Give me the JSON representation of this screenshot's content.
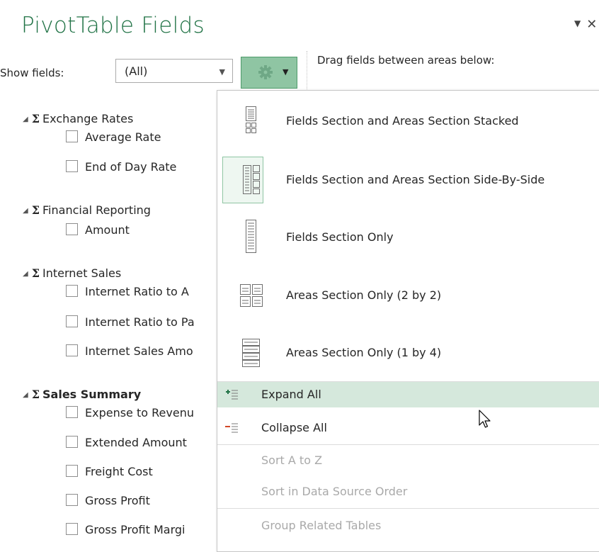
{
  "pane": {
    "title": "PivotTable Fields",
    "controls": {
      "dropdown_glyph": "▼",
      "close_glyph": "✕"
    },
    "show_fields_label": "Show fields:",
    "show_fields_value": "(All)",
    "drag_hint": "Drag fields between areas below:"
  },
  "field_groups": [
    {
      "name": "Exchange Rates",
      "bold": false,
      "fields": [
        "Average Rate",
        "End of Day Rate"
      ]
    },
    {
      "name": "Financial Reporting",
      "bold": false,
      "fields": [
        "Amount"
      ]
    },
    {
      "name": "Internet Sales",
      "bold": false,
      "fields": [
        "Internet Ratio to A",
        "Internet Ratio to Pa",
        "Internet Sales Amo"
      ]
    },
    {
      "name": "Sales Summary",
      "bold": true,
      "fields": [
        "Expense to Revenu",
        "Extended Amount",
        "Freight Cost",
        "Gross Profit",
        "Gross Profit Margi"
      ]
    }
  ],
  "tools_menu": {
    "layout_options": [
      {
        "label": "Fields Section and Areas Section Stacked",
        "icon": "layout-stacked-icon",
        "selected": false
      },
      {
        "label": "Fields Section and Areas Section Side-By-Side",
        "icon": "layout-side-by-side-icon",
        "selected": true
      },
      {
        "label": "Fields Section Only",
        "icon": "layout-fields-only-icon",
        "selected": false
      },
      {
        "label": "Areas Section Only (2 by 2)",
        "icon": "layout-areas-2x2-icon",
        "selected": false
      },
      {
        "label": "Areas Section Only (1 by 4)",
        "icon": "layout-areas-1x4-icon",
        "selected": false
      }
    ],
    "commands": [
      {
        "label": "Expand All",
        "icon": "expand-all-icon",
        "enabled": true,
        "hover": true
      },
      {
        "label": "Collapse All",
        "icon": "collapse-all-icon",
        "enabled": true,
        "hover": false
      },
      {
        "label": "Sort A to Z",
        "enabled": false
      },
      {
        "label": "Sort in Data Source Order",
        "enabled": false
      },
      {
        "label": "Group Related Tables",
        "enabled": false
      }
    ]
  },
  "colors": {
    "title_green": "#217346",
    "tools_button_bg": "#8fc5a3",
    "hover_bg": "#d5e8dc",
    "expand_plus": "#217346",
    "collapse_minus": "#d24726"
  }
}
